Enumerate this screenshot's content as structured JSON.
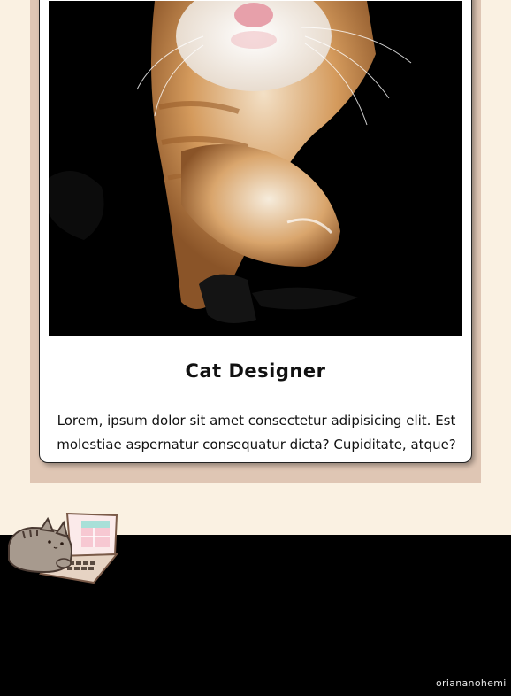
{
  "card": {
    "title": "Cat Designer",
    "description": "Lorem, ipsum dolor sit amet consectetur adipisicing elit. Est molestiae aspernatur consequatur dicta? Cupiditate, atque?",
    "photo_icon": "cat-photo"
  },
  "footer": {
    "credit": "oriananohemi",
    "mascot_icon": "cat-laptop-icon"
  },
  "colors": {
    "page_background": "#faf1e2",
    "card_frame": "#dfc6b4",
    "footer_background": "#000000"
  }
}
